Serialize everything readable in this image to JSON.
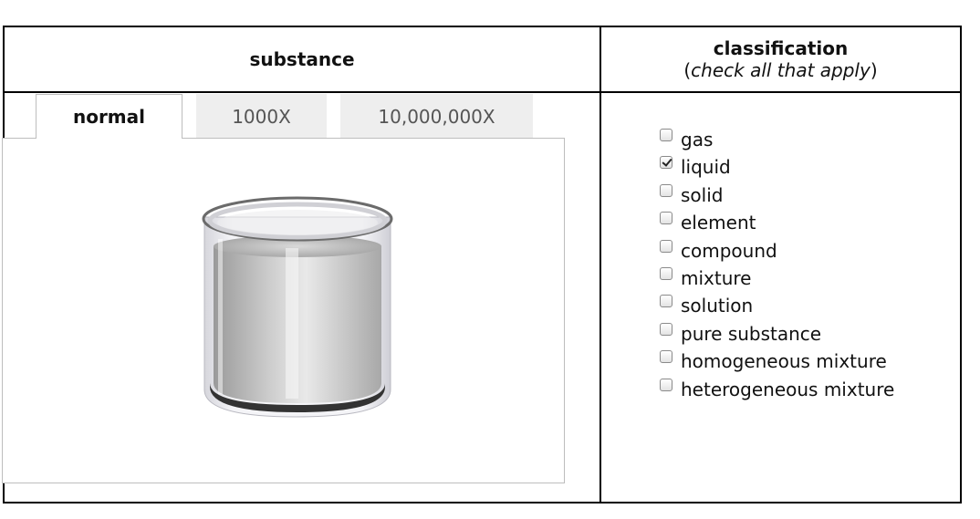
{
  "header": {
    "substance": "substance",
    "classification_title": "classification",
    "classification_hint": "check all that apply"
  },
  "tabs": [
    {
      "label": "normal",
      "active": true
    },
    {
      "label": "1000X",
      "active": false
    },
    {
      "label": "10,000,000X",
      "active": false
    }
  ],
  "beaker": {
    "content_color": "#bdbdbd",
    "glass_color": "#e8e8ec"
  },
  "classification": {
    "options": [
      {
        "label": "gas",
        "checked": false
      },
      {
        "label": "liquid",
        "checked": true
      },
      {
        "label": "solid",
        "checked": false
      },
      {
        "label": "element",
        "checked": false
      },
      {
        "label": "compound",
        "checked": false
      },
      {
        "label": "mixture",
        "checked": false
      },
      {
        "label": "solution",
        "checked": false
      },
      {
        "label": "pure substance",
        "checked": false
      },
      {
        "label": "homogeneous mixture",
        "checked": false
      },
      {
        "label": "heterogeneous mixture",
        "checked": false
      }
    ]
  }
}
